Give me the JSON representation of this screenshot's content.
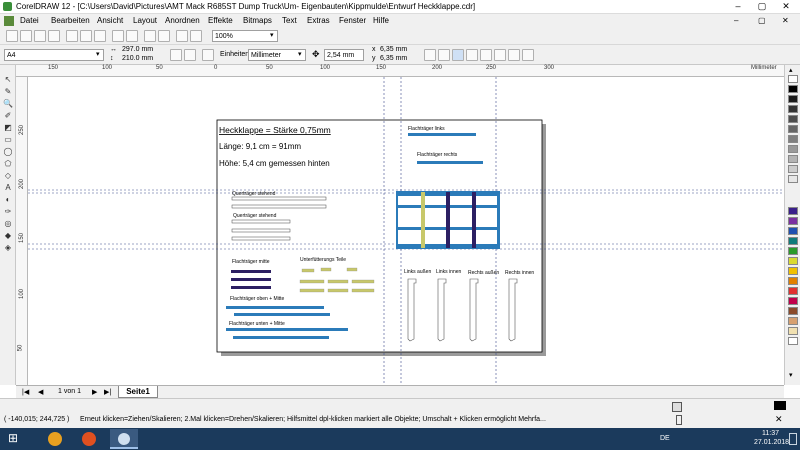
{
  "window": {
    "title": "CorelDRAW 12 - [C:\\Users\\David\\Pictures\\AMT Mack R685ST Dump Truck\\Um- Eigenbauten\\Kippmulde\\Entwurf Heckklappe.cdr]",
    "controls": [
      "–",
      "▢",
      "✕"
    ]
  },
  "menu": [
    "Datei",
    "Bearbeiten",
    "Ansicht",
    "Layout",
    "Anordnen",
    "Effekte",
    "Bitmaps",
    "Text",
    "Extras",
    "Fenster",
    "Hilfe"
  ],
  "toolbar": {
    "zoom": "100%"
  },
  "property_bar": {
    "paper": "A4",
    "width": "297.0 mm",
    "height": "210.0 mm",
    "units_label": "Einheiten:",
    "units": "Millimeter",
    "nudge": "2,54 mm",
    "dup_x": "6,35 mm",
    "dup_y": "6,35 mm"
  },
  "rulers": {
    "h_ticks": [
      "150",
      "100",
      "50",
      "0",
      "50",
      "100",
      "150",
      "200",
      "250",
      "300"
    ],
    "h_unit": "Millimeter",
    "v_ticks": [
      "250",
      "200",
      "150",
      "100",
      "50"
    ],
    "v_unit": "Millimeter"
  },
  "drawing": {
    "title": "Heckklappe = Stärke 0,75mm",
    "line1": "Länge: 9,1 cm = 91mm",
    "line2": "Höhe: 5,4 cm gemessen hinten",
    "label_flach_links": "Flachträger links",
    "label_flach_rechts": "Flachträger rechts",
    "label_quer1": "Querträger stehend",
    "label_quer2": "Querträger stehend",
    "label_flach_mitte": "Flachträger mitte",
    "label_unterf": "Unterfütterungs Teile",
    "label_flach_oben": "Flachträger oben + Mitte",
    "label_flach_unten": "Flachträger unten + Mitte",
    "label_links_aussen": "Links außen",
    "label_links_innen": "Links innen",
    "label_rechts_aussen": "Rechts außen",
    "label_rechts_innen": "Rechts innen"
  },
  "colors": {
    "blue": "#2b7bb9",
    "navy": "#2c1f63",
    "olive": "#c8c86a",
    "guide": "#3a4a8a"
  },
  "palette": [
    "#ffffff",
    "#000000",
    "#1a1a1a",
    "#333333",
    "#4d4d4d",
    "#666666",
    "#808080",
    "#999999",
    "#b3b3b3",
    "#cccccc",
    "#e6e6e6",
    "#3a1f8a",
    "#7b2fa0",
    "#1f4fb0",
    "#0f7a7a",
    "#2a9a2a",
    "#d9d930",
    "#f0c000",
    "#e08000",
    "#e03030",
    "#c0004a",
    "#8a4a2a",
    "#d6a070",
    "#f0e0b0",
    "#ffffff"
  ],
  "page_tabs": {
    "nav": [
      "|◀",
      "◀",
      "▶",
      "▶|"
    ],
    "count": "1 von 1",
    "tab": "Seite1"
  },
  "status": {
    "coords": "( -140,015; 244,725 )",
    "hint": "Erneut klicken=Ziehen/Skalieren; 2.Mal klicken=Drehen/Skalieren; Hilfsmittel dpl-klicken markiert alle Objekte; Umschalt + Klicken ermöglicht Mehrfa..."
  },
  "taskbar": {
    "lang": "DE",
    "time": "11:37",
    "date": "27.01.2018"
  }
}
